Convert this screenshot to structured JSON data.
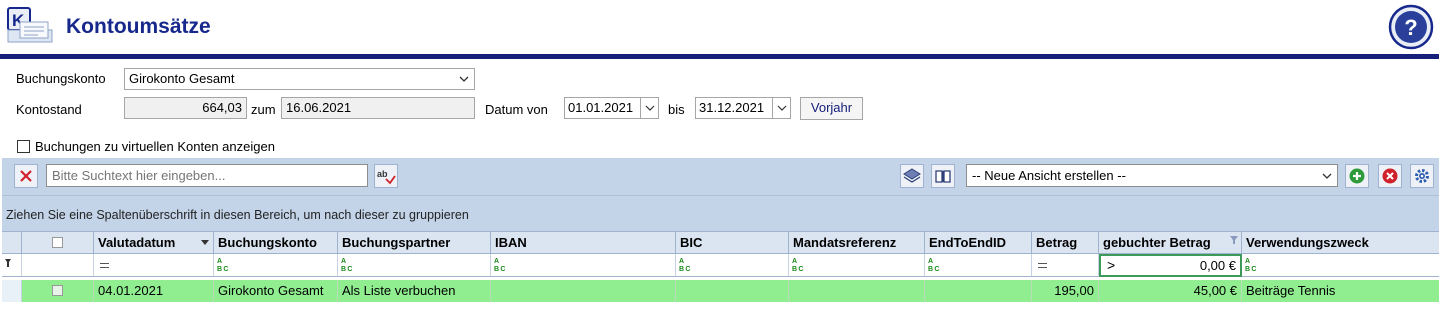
{
  "header": {
    "title": "Kontoumsätze",
    "logo_icon": "kontoumsaetze-logo-icon",
    "help_icon": "help-icon"
  },
  "form": {
    "account_label": "Buchungskonto",
    "account_value": "Girokonto Gesamt",
    "balance_label": "Kontostand",
    "balance_value": "664,03",
    "balance_date_label": "zum",
    "balance_date": "16.06.2021",
    "date_from_label": "Datum von",
    "date_from": "01.01.2021",
    "date_to_label": "bis",
    "date_to": "31.12.2021",
    "prev_year_button": "Vorjahr",
    "virtual_accounts_label": "Buchungen zu virtuellen Konten anzeigen"
  },
  "toolbar": {
    "search_placeholder": "Bitte Suchtext hier eingeben...",
    "view_select_value": "-- Neue Ansicht erstellen --"
  },
  "grid": {
    "group_hint": "Ziehen Sie eine Spaltenüberschrift in diesen Bereich, um nach dieser zu gruppieren",
    "columns": [
      "Valutadatum",
      "Buchungskonto",
      "Buchungspartner",
      "IBAN",
      "BIC",
      "Mandatsreferenz",
      "EndToEndID",
      "Betrag",
      "gebuchter Betrag",
      "Verwendungszweck"
    ],
    "filter": {
      "gebuchter_betrag_op": ">",
      "gebuchter_betrag_value": "0,00 €"
    },
    "rows": [
      {
        "valutadatum": "04.01.2021",
        "buchungskonto": "Girokonto Gesamt",
        "buchungspartner": "Als Liste verbuchen",
        "iban": "",
        "bic": "",
        "mandatsreferenz": "",
        "endtoendid": "",
        "betrag": "195,00",
        "gebuchter_betrag": "45,00 €",
        "verwendungszweck": "Beiträge Tennis"
      }
    ]
  },
  "colors": {
    "brand": "#17288c",
    "header_rule": "#16207a",
    "toolbar_bg": "#c3d4e9",
    "row_highlight": "#90ee90"
  }
}
